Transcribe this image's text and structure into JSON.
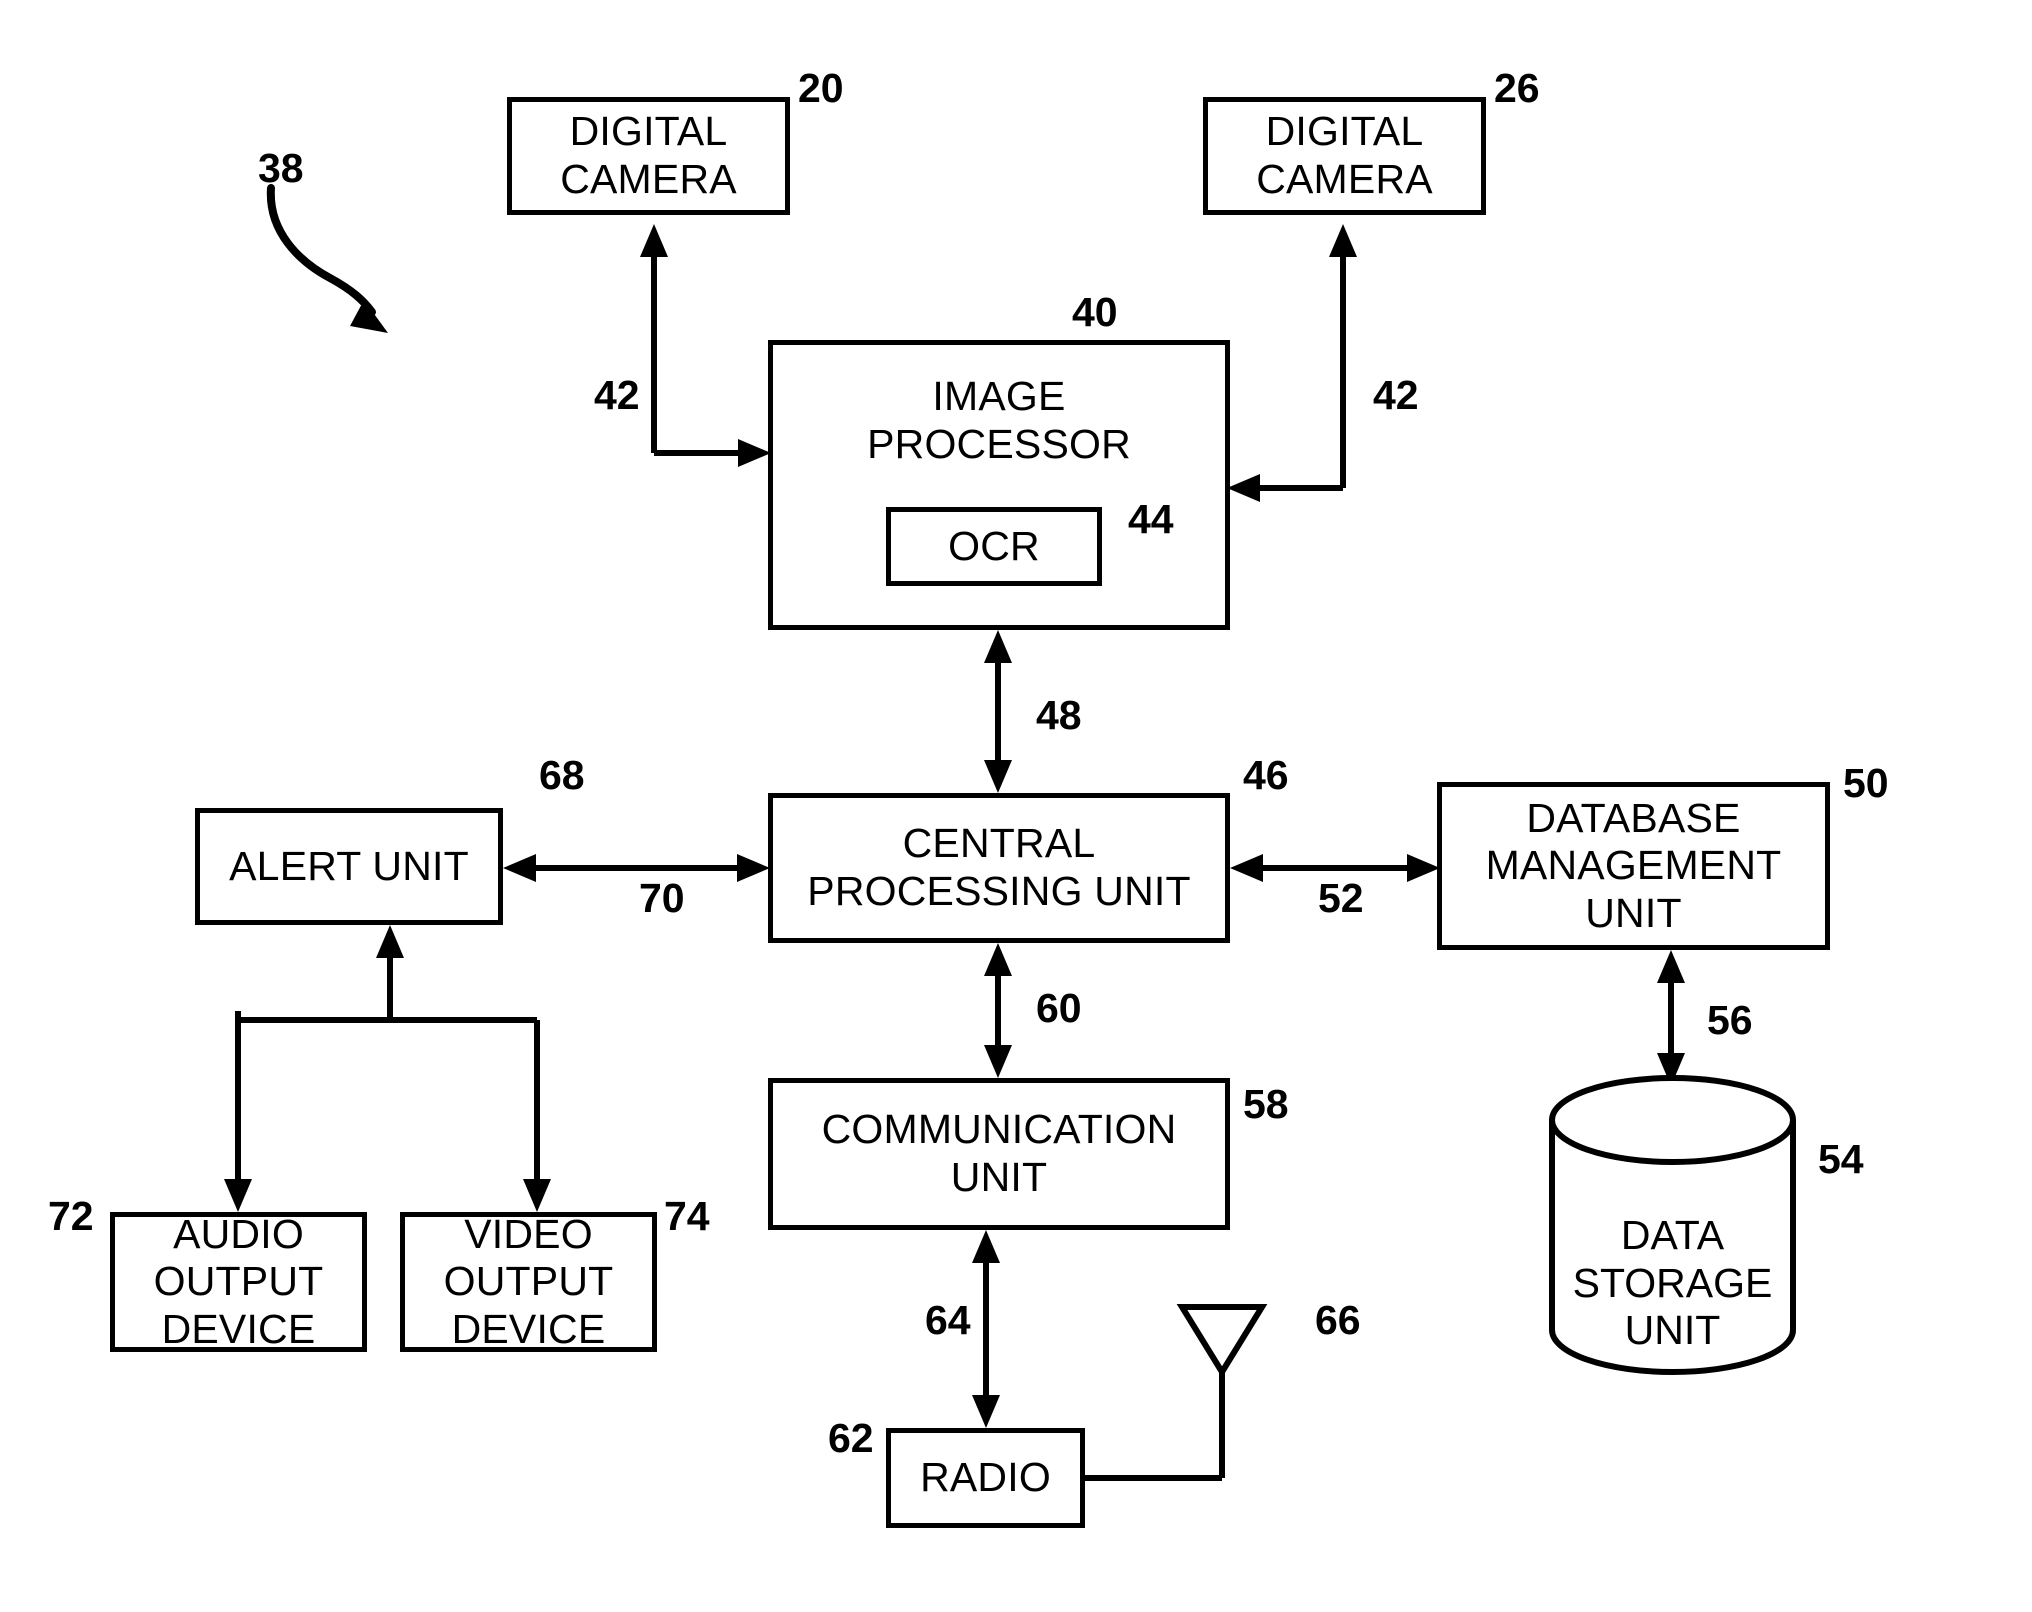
{
  "figure": {
    "type": "patent-block-diagram",
    "system_ref": "38",
    "background": "#ffffff",
    "stroke": "#000000"
  },
  "nodes": {
    "digital_camera_left": {
      "label": "DIGITAL\nCAMERA",
      "ref": "20"
    },
    "digital_camera_right": {
      "label": "DIGITAL\nCAMERA",
      "ref": "26"
    },
    "image_processor": {
      "label": "IMAGE\nPROCESSOR",
      "ref": "40"
    },
    "ocr": {
      "label": "OCR",
      "ref": "44"
    },
    "central_processing_unit": {
      "label": "CENTRAL\nPROCESSING UNIT",
      "ref": "46"
    },
    "alert_unit": {
      "label": "ALERT UNIT",
      "ref": "68"
    },
    "audio_output_device": {
      "label": "AUDIO\nOUTPUT\nDEVICE",
      "ref": "72"
    },
    "video_output_device": {
      "label": "VIDEO\nOUTPUT\nDEVICE",
      "ref": "74"
    },
    "database_management_unit": {
      "label": "DATABASE\nMANAGEMENT\nUNIT",
      "ref": "50"
    },
    "data_storage_unit": {
      "label": "DATA\nSTORAGE\nUNIT",
      "ref": "54"
    },
    "communication_unit": {
      "label": "COMMUNICATION\nUNIT",
      "ref": "58"
    },
    "radio": {
      "label": "RADIO",
      "ref": "62"
    },
    "antenna": {
      "label": "",
      "ref": "66"
    }
  },
  "connectors": {
    "camera_left_to_processor": {
      "ref": "42"
    },
    "camera_right_to_processor": {
      "ref": "42"
    },
    "processor_to_cpu": {
      "ref": "48"
    },
    "cpu_to_alert_unit": {
      "ref": "70"
    },
    "cpu_to_database": {
      "ref": "52"
    },
    "database_to_storage": {
      "ref": "56"
    },
    "cpu_to_communication": {
      "ref": "60"
    },
    "communication_to_radio": {
      "ref": "64"
    }
  }
}
